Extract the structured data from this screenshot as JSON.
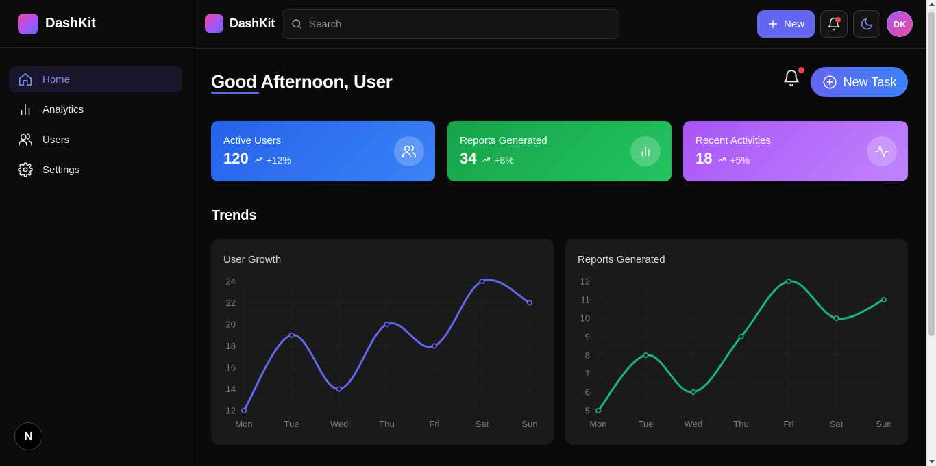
{
  "app": {
    "name": "DashKit"
  },
  "sidebar": {
    "items": [
      {
        "label": "Home",
        "icon": "home-icon",
        "active": true
      },
      {
        "label": "Analytics",
        "icon": "bar-chart-icon",
        "active": false
      },
      {
        "label": "Users",
        "icon": "users-icon",
        "active": false
      },
      {
        "label": "Settings",
        "icon": "gear-icon",
        "active": false
      }
    ],
    "footer_badge": "N"
  },
  "topbar": {
    "search_placeholder": "Search",
    "new_label": "New",
    "avatar_initials": "DK"
  },
  "main": {
    "greeting": "Good Afternoon, User",
    "new_task_label": "New Task",
    "trends_title": "Trends"
  },
  "stats": [
    {
      "title": "Active Users",
      "value": "120",
      "trend": "+12%",
      "icon": "users-icon",
      "color": "#2563eb"
    },
    {
      "title": "Reports Generated",
      "value": "34",
      "trend": "+8%",
      "icon": "bar-chart-icon",
      "color": "#16a34a"
    },
    {
      "title": "Recent Activities",
      "value": "18",
      "trend": "+5%",
      "icon": "activity-icon",
      "color": "#a855f7"
    }
  ],
  "colors": {
    "accent": "#6366f1",
    "green": "#10b981",
    "danger": "#ef4444"
  },
  "chart_data": [
    {
      "type": "line",
      "title": "User Growth",
      "categories": [
        "Mon",
        "Tue",
        "Wed",
        "Thu",
        "Fri",
        "Sat",
        "Sun"
      ],
      "series": [
        {
          "values": [
            12,
            19,
            14,
            20,
            18,
            24,
            22
          ]
        }
      ],
      "ylim": [
        12,
        24
      ],
      "yticks": [
        12,
        14,
        16,
        18,
        20,
        22,
        24
      ],
      "color": "#6366f1",
      "grid": true,
      "smooth": true
    },
    {
      "type": "line",
      "title": "Reports Generated",
      "categories": [
        "Mon",
        "Tue",
        "Wed",
        "Thu",
        "Fri",
        "Sat",
        "Sun"
      ],
      "series": [
        {
          "values": [
            5,
            8,
            6,
            9,
            12,
            10,
            11
          ]
        }
      ],
      "ylim": [
        5,
        12
      ],
      "yticks": [
        5,
        6,
        7,
        8,
        9,
        10,
        11,
        12
      ],
      "color": "#10b981",
      "grid": true,
      "smooth": true
    }
  ]
}
